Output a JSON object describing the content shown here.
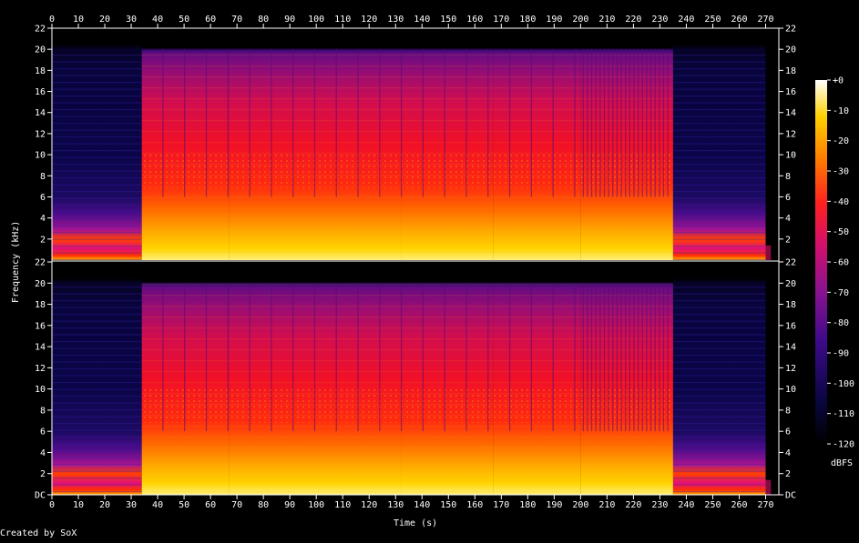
{
  "chart_data": {
    "type": "heatmap",
    "subtype": "spectrogram",
    "channels": 2,
    "xlabel": "Time (s)",
    "ylabel": "Frequency (kHz)",
    "xlim": [
      0,
      275
    ],
    "ylim_khz": [
      0,
      22
    ],
    "x_ticks": [
      0,
      10,
      20,
      30,
      40,
      50,
      60,
      70,
      80,
      90,
      100,
      110,
      120,
      130,
      140,
      150,
      160,
      170,
      180,
      190,
      200,
      210,
      220,
      230,
      240,
      250,
      260,
      270
    ],
    "y_tick_labels": [
      "DC",
      "2",
      "4",
      "6",
      "8",
      "10",
      "12",
      "14",
      "16",
      "18",
      "20",
      "22"
    ],
    "colorbar": {
      "label": "dBFS",
      "range": [
        -120,
        0
      ],
      "tick_labels": [
        "+0",
        "-10",
        "-20",
        "-30",
        "-40",
        "-50",
        "-60",
        "-70",
        "-80",
        "-90",
        "-100",
        "-110",
        "-120"
      ]
    },
    "segments": [
      {
        "t_start": 0,
        "t_end": 34,
        "level": "low",
        "top_khz": 20
      },
      {
        "t_start": 34,
        "t_end": 67,
        "level": "high",
        "top_khz": 20
      },
      {
        "t_start": 67,
        "t_end": 132,
        "level": "high",
        "top_khz": 20
      },
      {
        "t_start": 132,
        "t_end": 167,
        "level": "high",
        "top_khz": 20
      },
      {
        "t_start": 167,
        "t_end": 200,
        "level": "high",
        "top_khz": 20
      },
      {
        "t_start": 200,
        "t_end": 235,
        "level": "high",
        "top_khz": 20
      },
      {
        "t_start": 235,
        "t_end": 270,
        "level": "low",
        "top_khz": 20
      }
    ],
    "footer": "Created by SoX"
  }
}
